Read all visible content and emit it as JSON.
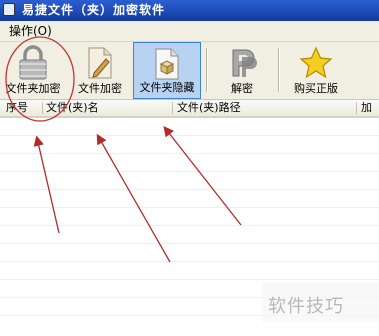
{
  "window": {
    "title": "易捷文件（夹）加密软件"
  },
  "menu": {
    "items": [
      {
        "label": "操作(O)"
      }
    ]
  },
  "toolbar": {
    "buttons": [
      {
        "label": "文件夹加密",
        "icon": "lock-icon"
      },
      {
        "label": "文件加密",
        "icon": "file-pencil-icon"
      },
      {
        "label": "文件夹隐藏",
        "icon": "box-page-icon",
        "active": true
      },
      {
        "label": "解密",
        "icon": "p-logo-icon"
      },
      {
        "label": "购买正版",
        "icon": "star-icon"
      }
    ]
  },
  "table": {
    "columns": [
      {
        "label": "序号"
      },
      {
        "label": "文件(夹)名"
      },
      {
        "label": "文件(夹)路径"
      },
      {
        "label": "加"
      }
    ],
    "rows": []
  },
  "watermark": {
    "text": "软件技巧"
  },
  "colors": {
    "annotation": "#b22a2a",
    "active_button": "#b8d2f2",
    "titlebar": "#1f4fbf"
  }
}
